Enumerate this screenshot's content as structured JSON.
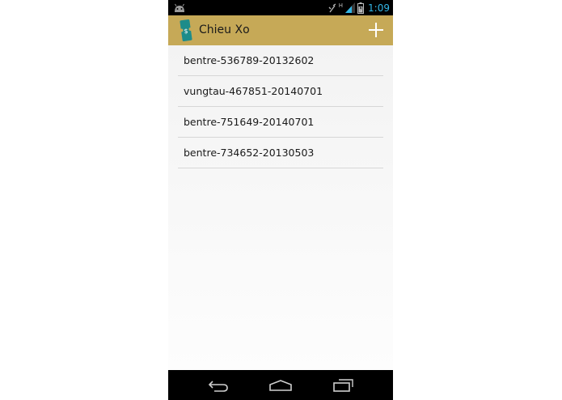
{
  "status_bar": {
    "time": "1:09",
    "time_color": "#33b5e5",
    "signal_label": "H"
  },
  "action_bar": {
    "title": "Chieu Xo",
    "background_color": "#c6a957",
    "icon_glyph": "$"
  },
  "list": {
    "items": [
      {
        "label": "bentre-536789-20132602"
      },
      {
        "label": "vungtau-467851-20140701"
      },
      {
        "label": "bentre-751649-20140701"
      },
      {
        "label": "bentre-734652-20130503"
      }
    ]
  },
  "navigation": {
    "icons": [
      "back-icon",
      "home-icon",
      "recent-apps-icon"
    ]
  }
}
